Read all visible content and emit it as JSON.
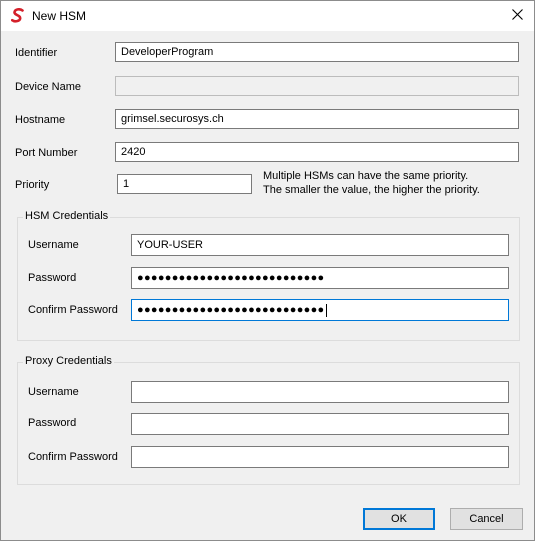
{
  "window": {
    "title": "New HSM",
    "app_icon": "securosys-s-logo",
    "close_icon": "close-x"
  },
  "fields": {
    "identifier": {
      "label": "Identifier",
      "value": "DeveloperProgram"
    },
    "device_name": {
      "label": "Device Name",
      "value": ""
    },
    "hostname": {
      "label": "Hostname",
      "value": "grimsel.securosys.ch"
    },
    "port_number": {
      "label": "Port Number",
      "value": "2420"
    },
    "priority": {
      "label": "Priority",
      "value": "1",
      "note_line1": "Multiple HSMs can have the same priority.",
      "note_line2": "The smaller the value, the higher the priority."
    }
  },
  "hsm_credentials": {
    "legend": "HSM Credentials",
    "username_label": "Username",
    "username_value": "YOUR-USER",
    "password_label": "Password",
    "password_value": "●●●●●●●●●●●●●●●●●●●●●●●●●●●",
    "confirm_label": "Confirm Password",
    "confirm_value": "●●●●●●●●●●●●●●●●●●●●●●●●●●●"
  },
  "proxy_credentials": {
    "legend": "Proxy Credentials",
    "username_label": "Username",
    "username_value": "",
    "password_label": "Password",
    "password_value": "",
    "confirm_label": "Confirm Password",
    "confirm_value": ""
  },
  "buttons": {
    "ok": "OK",
    "cancel": "Cancel"
  },
  "colors": {
    "accent": "#0078d7",
    "logo_red": "#d4202a"
  }
}
